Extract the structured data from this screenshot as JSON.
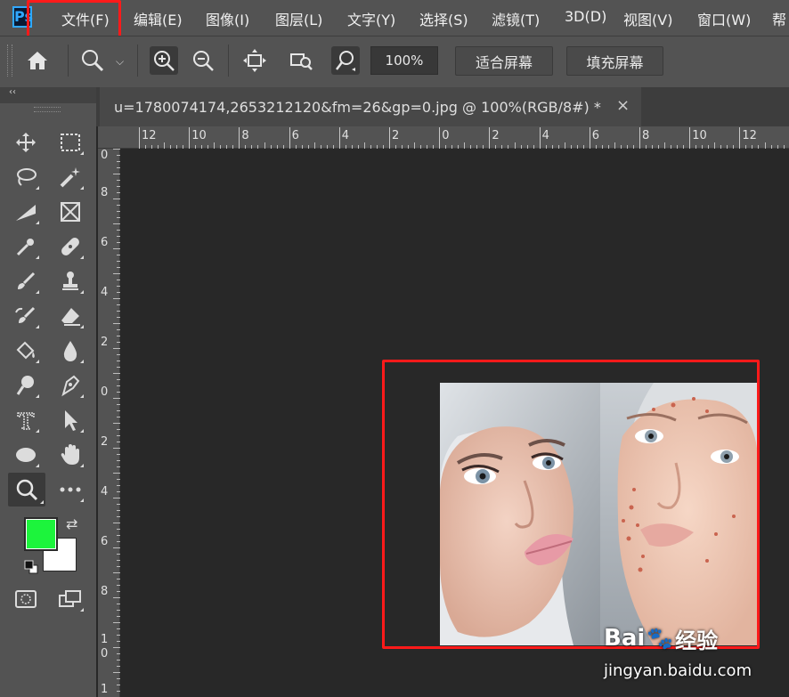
{
  "app": {
    "logo_label": "Ps",
    "menu": [
      "文件(F)",
      "编辑(E)",
      "图像(I)",
      "图层(L)",
      "文字(Y)",
      "选择(S)",
      "滤镜(T)",
      "3D(D)",
      "视图(V)",
      "窗口(W)",
      "帮"
    ]
  },
  "options_bar": {
    "zoom_value": "100%",
    "fit_screen_label": "适合屏幕",
    "fill_screen_label": "填充屏幕"
  },
  "document": {
    "tab_title": "u=1780074174,2653212120&fm=26&gp=0.jpg @ 100%(RGB/8#) *",
    "close_glyph": "×"
  },
  "rulers": {
    "horizontal": [
      "12",
      "10",
      "8",
      "6",
      "4",
      "2",
      "0",
      "2",
      "4",
      "6",
      "8",
      "10",
      "12"
    ],
    "vertical": [
      "0",
      "8",
      "6",
      "4",
      "2",
      "0",
      "2",
      "4",
      "6",
      "8",
      "1",
      "0",
      "1"
    ]
  },
  "colors": {
    "foreground": "#1cf43c",
    "background": "#ffffff",
    "highlight": "#ff1a1a"
  },
  "watermark": {
    "brand": "Bai",
    "brand_suffix": "经验",
    "url": "jingyan.baidu.com"
  }
}
